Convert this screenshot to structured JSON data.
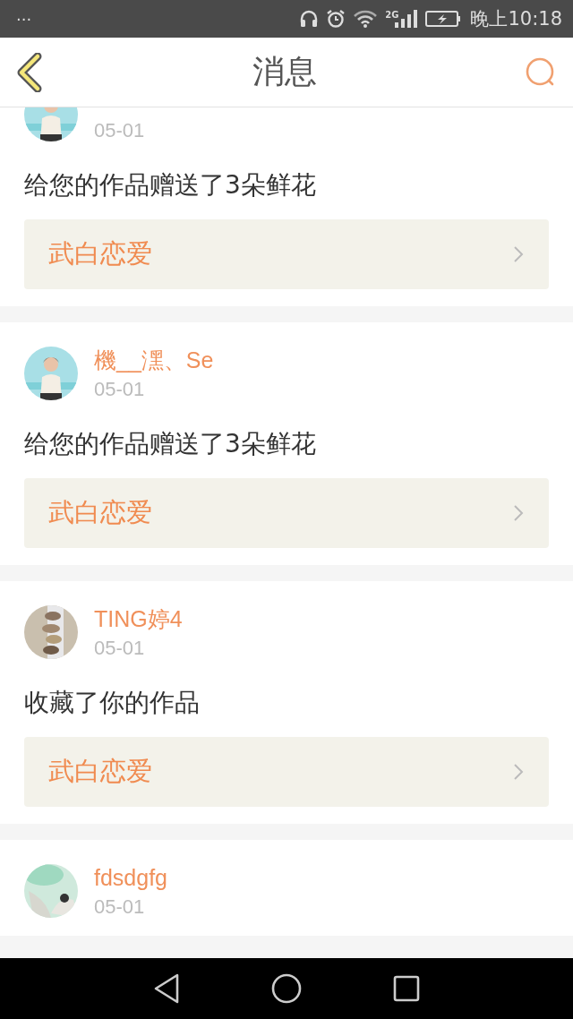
{
  "status_bar": {
    "menu_dots": "···",
    "network": "2G",
    "time": "晚上10:18"
  },
  "header": {
    "title": "消息"
  },
  "messages": [
    {
      "date": "05-01",
      "text": "给您的作品赠送了3朵鲜花",
      "work": "武白恋爱"
    },
    {
      "name": "機__潶、Se",
      "date": "05-01",
      "text": "给您的作品赠送了3朵鲜花",
      "work": "武白恋爱"
    },
    {
      "name": "TING婷4",
      "date": "05-01",
      "text": "收藏了你的作品",
      "work": "武白恋爱"
    },
    {
      "name": "fdsdgfg",
      "date": "05-01"
    }
  ]
}
